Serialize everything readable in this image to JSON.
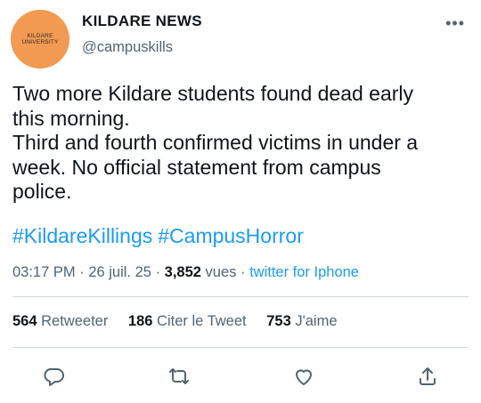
{
  "account": {
    "avatar_text_line1": "KILDARE",
    "avatar_text_line2": "UNIVERSITY",
    "display_name": "KILDARE NEWS",
    "handle": "@campuskills",
    "avatar_color": "#f29a52"
  },
  "tweet": {
    "lines": [
      "Two more Kildare students found dead early",
      "this morning.",
      "Third and fourth confirmed victims in under a",
      "week. No official statement from campus",
      "police."
    ],
    "hashtags": [
      "#KildareKillings",
      "#CampusHorror"
    ],
    "time": "03:17 PM",
    "date": "26 juil. 25",
    "views_count": "3,852",
    "views_label": "vues",
    "source": "twitter for Iphone"
  },
  "stats": {
    "retweets_count": "564",
    "retweets_label": "Retweeter",
    "quotes_count": "186",
    "quotes_label": "Citer le Tweet",
    "likes_count": "753",
    "likes_label": "J'aime"
  },
  "actions": {
    "reply_icon": "reply-icon",
    "retweet_icon": "retweet-icon",
    "like_icon": "heart-icon",
    "share_icon": "share-icon"
  },
  "colors": {
    "link": "#1d9bf0",
    "secondary_text": "#536471",
    "divider": "#cfd9de"
  }
}
